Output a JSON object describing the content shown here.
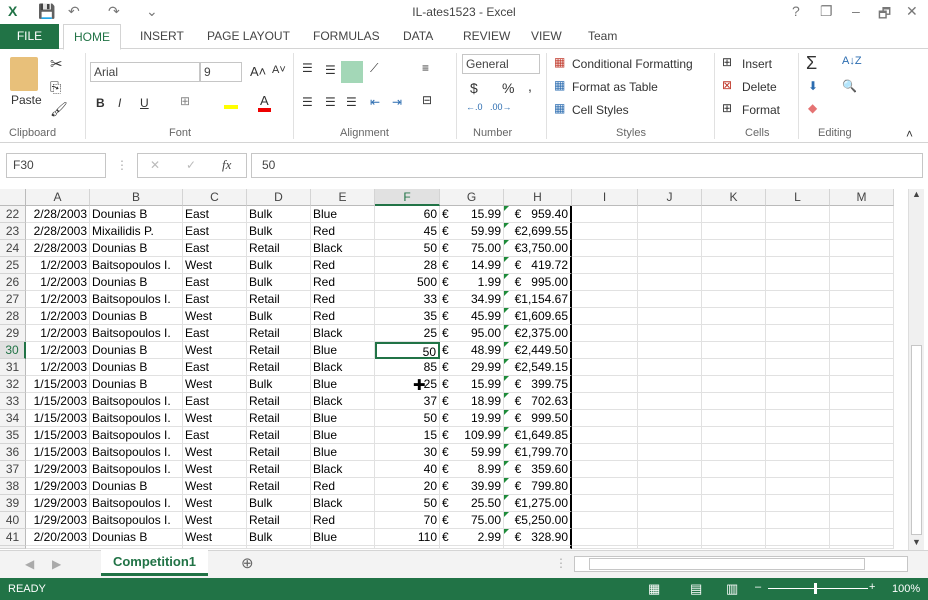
{
  "window": {
    "title": "IL-ates1523 - Excel",
    "help": "?",
    "restore": "❐",
    "minimize": "–",
    "maximize": "🗗",
    "close": "✕"
  },
  "ribbon_tabs": [
    "FILE",
    "HOME",
    "INSERT",
    "PAGE LAYOUT",
    "FORMULAS",
    "DATA",
    "REVIEW",
    "VIEW",
    "Team"
  ],
  "clipboard": {
    "paste": "Paste",
    "label": "Clipboard"
  },
  "font": {
    "name": "Arial",
    "size": "9",
    "bold": "B",
    "italic": "I",
    "underline": "U",
    "label": "Font"
  },
  "alignment": {
    "label": "Alignment"
  },
  "number": {
    "format": "General",
    "currency": "$",
    "percent": "%",
    "comma": ",",
    "label": "Number"
  },
  "styles": {
    "conditional": "Conditional Formatting",
    "table": "Format as Table",
    "cell_styles": "Cell Styles",
    "label": "Styles"
  },
  "cells": {
    "insert": "Insert",
    "delete": "Delete",
    "format": "Format",
    "label": "Cells"
  },
  "editing": {
    "label": "Editing"
  },
  "formula_bar": {
    "name_box": "F30",
    "formula": "50",
    "fx": "fx"
  },
  "columns": [
    "A",
    "B",
    "C",
    "D",
    "E",
    "F",
    "G",
    "H",
    "I",
    "J",
    "K",
    "L",
    "M"
  ],
  "selected_cell": {
    "column": "F",
    "row": "30"
  },
  "rows": [
    [
      "22",
      "2/28/2003",
      "Dounias B",
      "East",
      "Bulk",
      "Blue",
      "60",
      "15.99",
      "€   959.40"
    ],
    [
      "23",
      "2/28/2003",
      "Mixailidis P.",
      "East",
      "Bulk",
      "Red",
      "45",
      "59.99",
      "€2,699.55"
    ],
    [
      "24",
      "2/28/2003",
      "Dounias B",
      "East",
      "Retail",
      "Black",
      "50",
      "75.00",
      "€3,750.00"
    ],
    [
      "25",
      "1/2/2003",
      "Baitsopoulos I.",
      "West",
      "Bulk",
      "Red",
      "28",
      "14.99",
      "€   419.72"
    ],
    [
      "26",
      "1/2/2003",
      "Dounias B",
      "East",
      "Bulk",
      "Red",
      "500",
      "1.99",
      "€   995.00"
    ],
    [
      "27",
      "1/2/2003",
      "Baitsopoulos I.",
      "East",
      "Retail",
      "Red",
      "33",
      "34.99",
      "€1,154.67"
    ],
    [
      "28",
      "1/2/2003",
      "Dounias B",
      "West",
      "Bulk",
      "Red",
      "35",
      "45.99",
      "€1,609.65"
    ],
    [
      "29",
      "1/2/2003",
      "Baitsopoulos I.",
      "East",
      "Retail",
      "Black",
      "25",
      "95.00",
      "€2,375.00"
    ],
    [
      "30",
      "1/2/2003",
      "Dounias B",
      "West",
      "Retail",
      "Blue",
      "50",
      "48.99",
      "€2,449.50"
    ],
    [
      "31",
      "1/2/2003",
      "Dounias B",
      "East",
      "Retail",
      "Black",
      "85",
      "29.99",
      "€2,549.15"
    ],
    [
      "32",
      "1/15/2003",
      "Dounias B",
      "West",
      "Bulk",
      "Blue",
      "25",
      "15.99",
      "€   399.75"
    ],
    [
      "33",
      "1/15/2003",
      "Baitsopoulos I.",
      "East",
      "Retail",
      "Black",
      "37",
      "18.99",
      "€   702.63"
    ],
    [
      "34",
      "1/15/2003",
      "Baitsopoulos I.",
      "West",
      "Retail",
      "Blue",
      "50",
      "19.99",
      "€   999.50"
    ],
    [
      "35",
      "1/15/2003",
      "Baitsopoulos I.",
      "East",
      "Retail",
      "Blue",
      "15",
      "109.99",
      "€1,649.85"
    ],
    [
      "36",
      "1/15/2003",
      "Baitsopoulos I.",
      "West",
      "Retail",
      "Blue",
      "30",
      "59.99",
      "€1,799.70"
    ],
    [
      "37",
      "1/29/2003",
      "Baitsopoulos I.",
      "West",
      "Retail",
      "Black",
      "40",
      "8.99",
      "€   359.60"
    ],
    [
      "38",
      "1/29/2003",
      "Dounias B",
      "West",
      "Retail",
      "Red",
      "20",
      "39.99",
      "€   799.80"
    ],
    [
      "39",
      "1/29/2003",
      "Baitsopoulos I.",
      "West",
      "Bulk",
      "Black",
      "50",
      "25.50",
      "€1,275.00"
    ],
    [
      "40",
      "1/29/2003",
      "Baitsopoulos I.",
      "West",
      "Retail",
      "Red",
      "70",
      "75.00",
      "€5,250.00"
    ],
    [
      "41",
      "2/20/2003",
      "Dounias B",
      "West",
      "Bulk",
      "Blue",
      "110",
      "2.99",
      "€   328.90"
    ]
  ],
  "currency_symbol": "€",
  "sheet_tabs": [
    "Competition1"
  ],
  "status": {
    "ready": "READY",
    "zoom": "100%"
  },
  "colors": {
    "accent": "#217346",
    "error_triangle": "#1e8b3a"
  }
}
